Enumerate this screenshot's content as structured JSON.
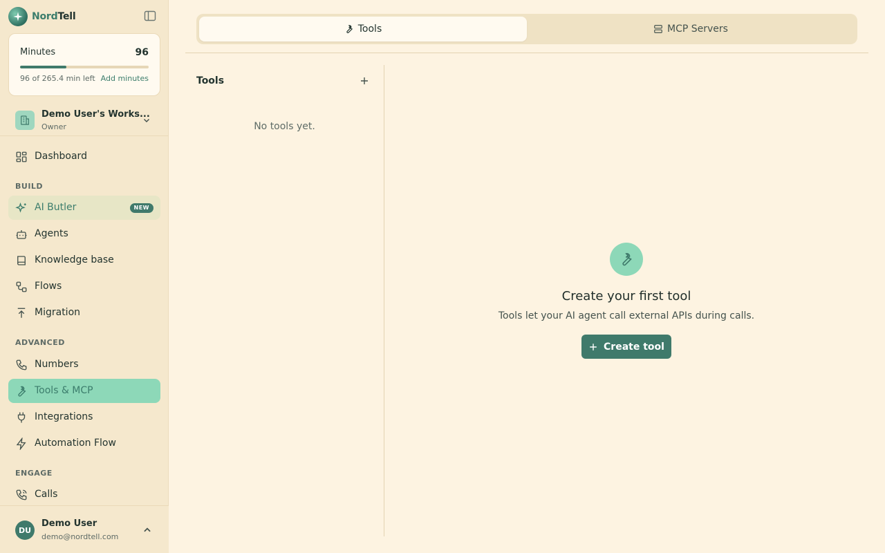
{
  "brand": {
    "name_a": "Nord",
    "name_b": "Tell"
  },
  "minutes": {
    "label": "Minutes",
    "value": "96",
    "progress_fraction": 0.362,
    "left_text": "96 of 265.4 min left",
    "add_label": "Add minutes"
  },
  "workspace": {
    "name": "Demo User's Works...",
    "role": "Owner"
  },
  "nav": {
    "dashboard": "Dashboard",
    "build_section": "BUILD",
    "ai_butler": "AI Butler",
    "new_badge": "NEW",
    "agents": "Agents",
    "knowledge_base": "Knowledge base",
    "flows": "Flows",
    "migration": "Migration",
    "advanced_section": "ADVANCED",
    "numbers": "Numbers",
    "tools_mcp": "Tools & MCP",
    "integrations": "Integrations",
    "automation_flow": "Automation Flow",
    "engage_section": "ENGAGE",
    "calls": "Calls"
  },
  "user": {
    "initials": "DU",
    "name": "Demo User",
    "email": "demo@nordtell.com"
  },
  "tabs": {
    "tools": "Tools",
    "mcp_servers": "MCP Servers"
  },
  "tools_panel": {
    "title": "Tools",
    "empty_text": "No tools yet."
  },
  "empty_state": {
    "title": "Create your first tool",
    "subtitle": "Tools let your AI agent call external APIs during calls.",
    "button_label": "Create tool"
  },
  "colors": {
    "accent": "#3f7a6b",
    "active_nav": "#8dd8b8",
    "background": "#fdf3e1",
    "sidebar": "#f5e8cd"
  },
  "icons": [
    "sparkle-logo",
    "sidebar-toggle-icon",
    "building-icon",
    "chevron-down-icon",
    "dashboard-icon",
    "sparkles-icon",
    "bot-icon",
    "book-icon",
    "flows-icon",
    "upload-icon",
    "phone-icon",
    "wrench-icon",
    "plug-icon",
    "zap-icon",
    "phone-call-icon",
    "chevron-up-icon",
    "server-icon",
    "plus-icon"
  ]
}
